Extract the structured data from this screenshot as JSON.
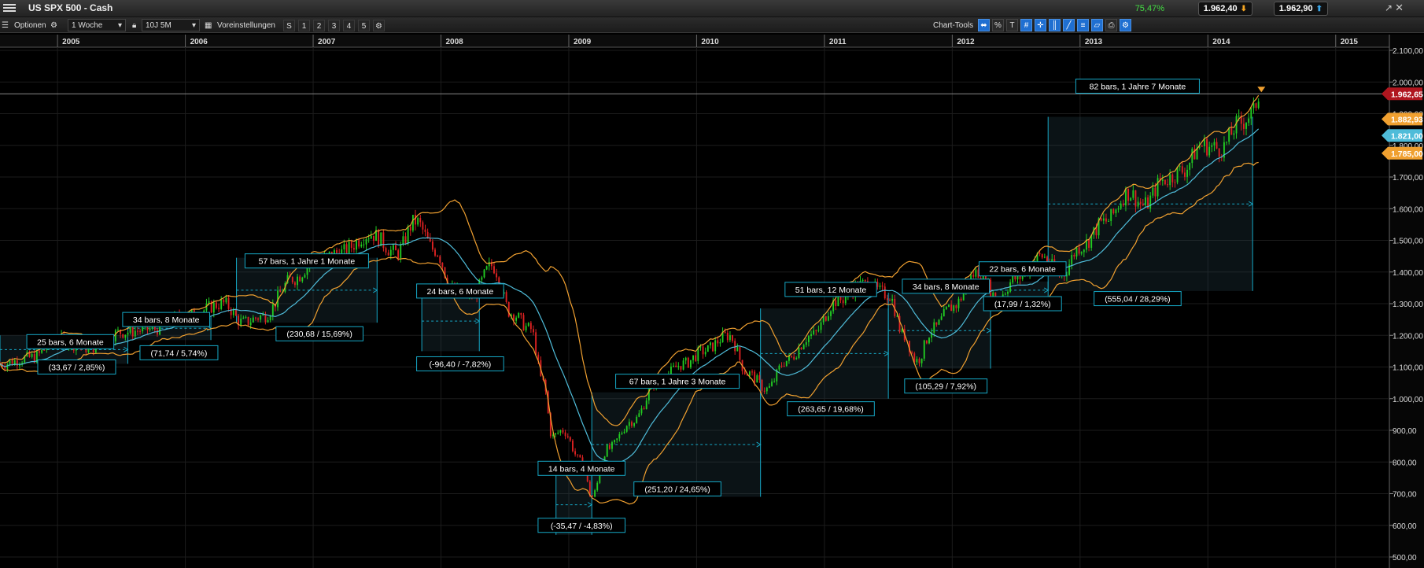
{
  "window": {
    "title": "US SPX 500 - Cash",
    "change_pct": "75,47%",
    "bid": "1.962,40",
    "ask": "1.962,90"
  },
  "toolbar": {
    "options_label": "Optionen",
    "interval_value": "1 Woche",
    "range_value": "10J 5M",
    "presets_label": "Voreinstellungen",
    "preset_numbers": [
      "S",
      "1",
      "2",
      "3",
      "4",
      "5"
    ],
    "chart_tools_label": "Chart-Tools",
    "tool_icons": [
      "indicator-icon",
      "percent-icon",
      "text-tool-icon",
      "grid-icon",
      "crosshair-icon",
      "candle-icon",
      "drawing-icon",
      "fibonacci-icon",
      "pattern-icon",
      "print-icon",
      "settings-icon"
    ]
  },
  "colors": {
    "bull": "#22cc22",
    "bear": "#dd2222",
    "bollinger": "#f0a030",
    "moving_average": "#4fbcd9",
    "price_label": "#b0161f",
    "upper_label": "#f0a030",
    "ma_label": "#4fbcd9",
    "range_box": "#16a8c6"
  },
  "chart_data": {
    "type": "candlestick",
    "symbol": "US SPX 500 - Cash",
    "interval": "1 Woche",
    "x_tick_labels": [
      "2005",
      "2006",
      "2007",
      "2008",
      "2009",
      "2010",
      "2011",
      "2012",
      "2013",
      "2014",
      "2015"
    ],
    "y_tick_labels": [
      "2.100,00",
      "2.000,00",
      "1.900,00",
      "1.800,00",
      "1.700,00",
      "1.600,00",
      "1.500,00",
      "1.400,00",
      "1.300,00",
      "1.200,00",
      "1.100,00",
      "1.000,00",
      "900,00",
      "800,00",
      "700,00",
      "600,00",
      "500,00"
    ],
    "ylim": [
      470,
      2115
    ],
    "price_labels": {
      "last": "1.962,65",
      "upper_band": "1.882,93",
      "moving_average": "1.821,00",
      "lower_band_partial": "1.785,00"
    },
    "price_path": [
      [
        2004.55,
        1110
      ],
      [
        2004.8,
        1130
      ],
      [
        2005.0,
        1185
      ],
      [
        2005.25,
        1160
      ],
      [
        2005.5,
        1210
      ],
      [
        2005.75,
        1220
      ],
      [
        2006.0,
        1260
      ],
      [
        2006.3,
        1300
      ],
      [
        2006.45,
        1240
      ],
      [
        2006.6,
        1260
      ],
      [
        2006.85,
        1380
      ],
      [
        2007.0,
        1430
      ],
      [
        2007.2,
        1460
      ],
      [
        2007.45,
        1520
      ],
      [
        2007.65,
        1460
      ],
      [
        2007.8,
        1560
      ],
      [
        2007.95,
        1470
      ],
      [
        2008.1,
        1340
      ],
      [
        2008.25,
        1330
      ],
      [
        2008.4,
        1420
      ],
      [
        2008.55,
        1270
      ],
      [
        2008.7,
        1220
      ],
      [
        2008.8,
        1050
      ],
      [
        2008.87,
        880
      ],
      [
        2008.95,
        900
      ],
      [
        2009.1,
        800
      ],
      [
        2009.18,
        690
      ],
      [
        2009.3,
        840
      ],
      [
        2009.5,
        930
      ],
      [
        2009.7,
        1060
      ],
      [
        2009.9,
        1110
      ],
      [
        2010.05,
        1150
      ],
      [
        2010.25,
        1200
      ],
      [
        2010.4,
        1080
      ],
      [
        2010.55,
        1030
      ],
      [
        2010.7,
        1120
      ],
      [
        2010.9,
        1200
      ],
      [
        2011.1,
        1310
      ],
      [
        2011.3,
        1360
      ],
      [
        2011.5,
        1330
      ],
      [
        2011.62,
        1200
      ],
      [
        2011.72,
        1120
      ],
      [
        2011.85,
        1220
      ],
      [
        2012.0,
        1290
      ],
      [
        2012.2,
        1400
      ],
      [
        2012.35,
        1320
      ],
      [
        2012.5,
        1380
      ],
      [
        2012.7,
        1450
      ],
      [
        2012.85,
        1390
      ],
      [
        2013.0,
        1480
      ],
      [
        2013.2,
        1560
      ],
      [
        2013.38,
        1650
      ],
      [
        2013.5,
        1610
      ],
      [
        2013.65,
        1690
      ],
      [
        2013.8,
        1720
      ],
      [
        2013.95,
        1800
      ],
      [
        2014.1,
        1790
      ],
      [
        2014.25,
        1870
      ],
      [
        2014.35,
        1900
      ],
      [
        2014.4,
        1962
      ]
    ],
    "range_boxes": [
      {
        "label": "25 bars, 6 Monate",
        "change": "(33,67 / 2,85%)"
      },
      {
        "label": "34 bars, 8 Monate",
        "change": "(71,74 / 5,74%)"
      },
      {
        "label": "57 bars, 1 Jahre 1 Monate",
        "change": "(230,68 / 15,69%)"
      },
      {
        "label": "24 bars, 6 Monate",
        "change": "(-96,40 / -7,82%)"
      },
      {
        "label": "14 bars, 4 Monate",
        "change": "(-35,47 / -4,83%)"
      },
      {
        "label": "67 bars, 1 Jahre 3 Monate",
        "change": "(251,20 / 24,65%)"
      },
      {
        "label": "51 bars, 12 Monate",
        "change": "(263,65 / 19,68%)"
      },
      {
        "label": "34 bars, 8 Monate",
        "change": "(105,29 / 7,92%)"
      },
      {
        "label": "22 bars, 6 Monate",
        "change": "(17,99 / 1,32%)"
      },
      {
        "label": "82 bars, 1 Jahre 7 Monate",
        "change": "(555,04 / 28,29%)"
      }
    ]
  }
}
